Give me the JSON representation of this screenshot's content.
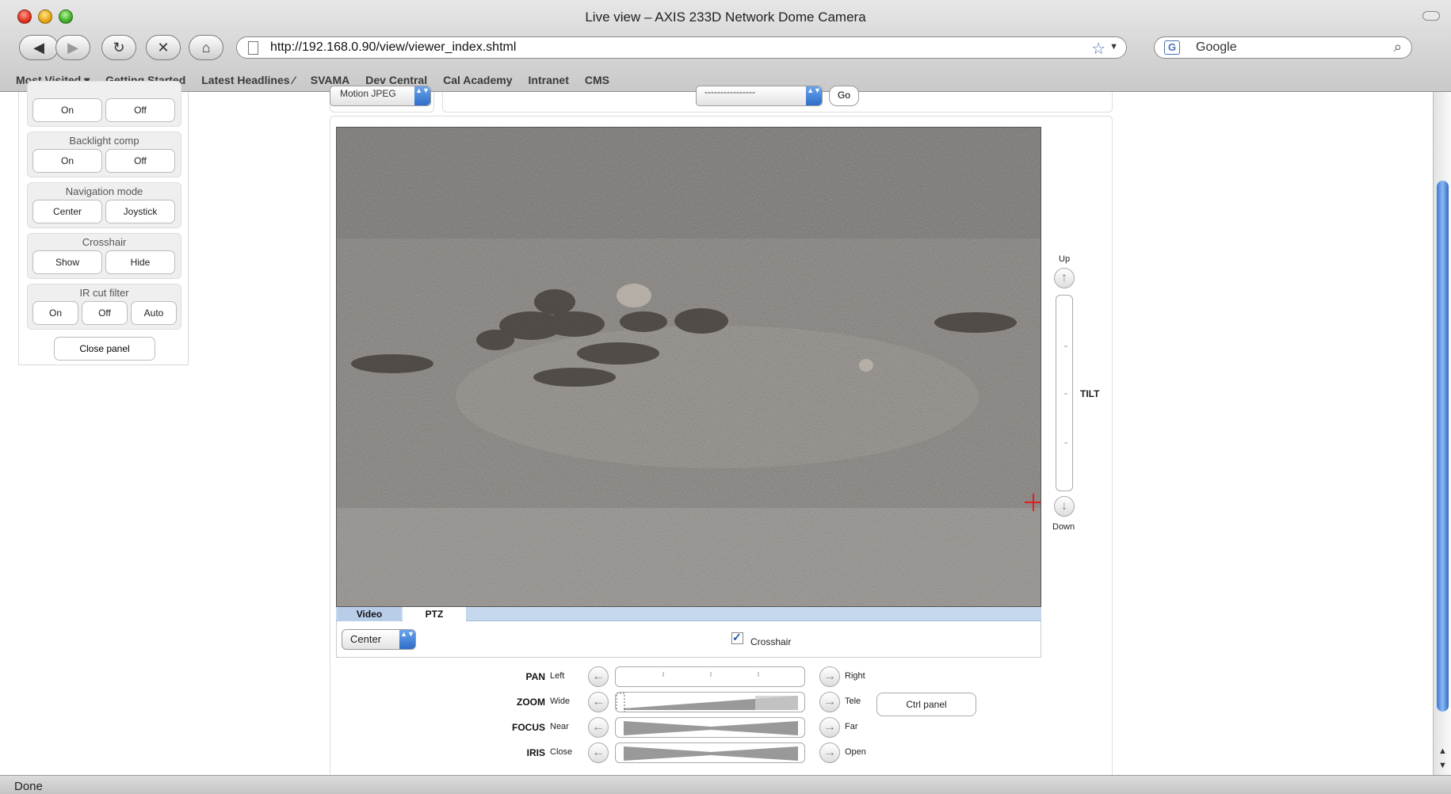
{
  "window": {
    "title": "Live view – AXIS 233D Network Dome Camera"
  },
  "toolbar": {
    "url": "http://192.168.0.90/view/viewer_index.shtml",
    "search_placeholder": "Google",
    "search_engine_icon": "G"
  },
  "bookmarks": [
    "Most Visited ▾",
    "Getting Started",
    "Latest Headlines ⁄",
    "SVAMA",
    "Dev Central",
    "Cal Academy",
    "Intranet",
    "CMS"
  ],
  "panel": {
    "groups": [
      {
        "label": "Backlight comp",
        "buttons": [
          "On",
          "Off"
        ]
      },
      {
        "label": "Navigation mode",
        "buttons": [
          "Center",
          "Joystick"
        ]
      },
      {
        "label": "Crosshair",
        "buttons": [
          "Show",
          "Hide"
        ]
      },
      {
        "label": "IR cut filter",
        "buttons": [
          "On",
          "Off",
          "Auto"
        ]
      }
    ],
    "top_buttons": [
      "On",
      "Off"
    ],
    "close_label": "Close panel"
  },
  "top": {
    "stream": "Motion JPEG",
    "preset": "----------------",
    "go": "Go"
  },
  "tabs": {
    "video": "Video",
    "ptz": "PTZ"
  },
  "ptz": {
    "nav_mode": "Center",
    "crosshair_label": "Crosshair",
    "crosshair_checked": true,
    "tilt": {
      "up": "Up",
      "down": "Down",
      "label": "TILT"
    },
    "rows": [
      {
        "name": "PAN",
        "min": "Left",
        "max": "Right"
      },
      {
        "name": "ZOOM",
        "min": "Wide",
        "max": "Tele"
      },
      {
        "name": "FOCUS",
        "min": "Near",
        "max": "Far"
      },
      {
        "name": "IRIS",
        "min": "Close",
        "max": "Open"
      }
    ],
    "ctrl_panel": "Ctrl panel"
  },
  "status": {
    "text": "Done"
  },
  "colors": {
    "crosshair": "#e02020",
    "scroll_thumb": "#3a79d9",
    "tab_bar": "#c5d8ee"
  }
}
